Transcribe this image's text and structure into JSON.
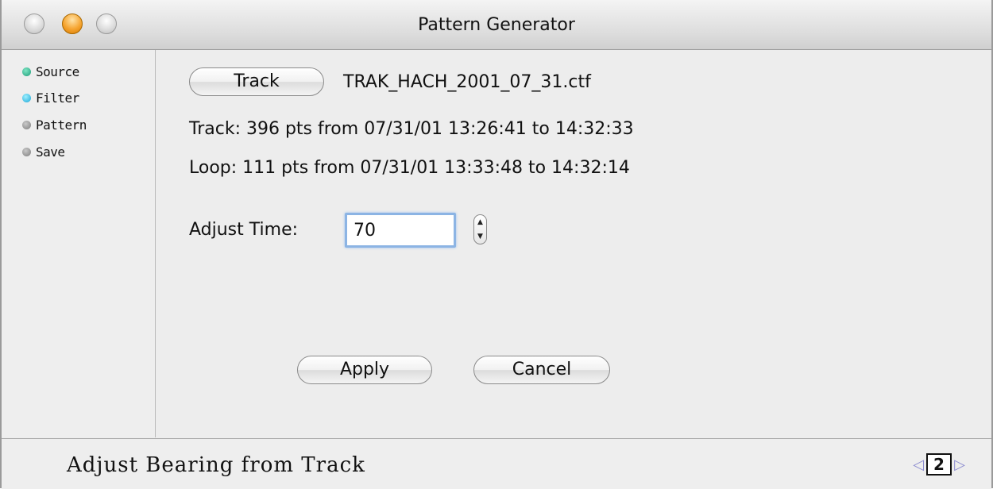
{
  "window": {
    "title": "Pattern Generator"
  },
  "sidebar": {
    "steps": [
      {
        "label": "Source",
        "color": "#1c9b78"
      },
      {
        "label": "Filter",
        "color": "#1aa6d6"
      },
      {
        "label": "Pattern",
        "color": "#7d7d7d"
      },
      {
        "label": "Save",
        "color": "#7d7d7d"
      }
    ]
  },
  "main": {
    "track_button": "Track",
    "track_file": "TRAK_HACH_2001_07_31.ctf",
    "track_info": "Track: 396 pts from 07/31/01 13:26:41 to 14:32:33",
    "loop_info": "Loop: 111 pts from 07/31/01 13:33:48 to 14:32:14",
    "adjust_time_label": "Adjust Time:",
    "adjust_time_value": "70",
    "apply_button": "Apply",
    "cancel_button": "Cancel"
  },
  "footer": {
    "title": "Adjust Bearing from Track",
    "page": "2",
    "prev_icon": "triangle-left-icon",
    "next_icon": "triangle-right-icon"
  }
}
